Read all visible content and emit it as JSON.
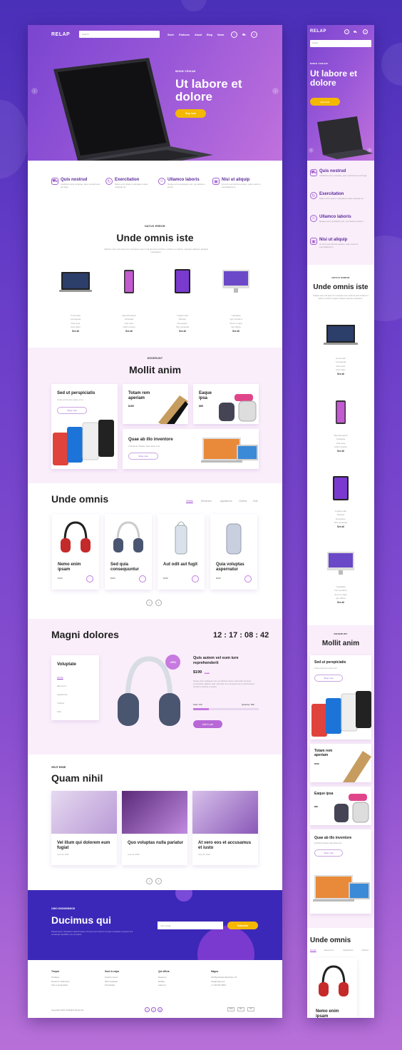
{
  "brand": "RELAP",
  "search_placeholder": "Search",
  "nav": [
    "Store",
    "Features",
    "About",
    "Blog",
    "News"
  ],
  "hero": {
    "kicker": "MINIM VENIAM",
    "title": "Ut labore et dolore",
    "button": "Buy now"
  },
  "features": [
    {
      "icon": "truck-icon",
      "title": "Quis nostrud",
      "text": "Incididunt quis voluptas, quis nostrud sed est fugit."
    },
    {
      "icon": "refresh-icon",
      "title": "Exercitation",
      "text": "Natus error ipsam voluptatem quia voluptas sit."
    },
    {
      "icon": "support-icon",
      "title": "Ullamco laboris",
      "text": "Neque porro quisquam est, qui dolorem ipsum."
    },
    {
      "icon": "box-icon",
      "title": "Nisi ut aliquip",
      "text": "Ut enim ad minima veniam, quis nostrum exercitationem."
    }
  ],
  "catalog": {
    "kicker": "NATUS ERROR",
    "title": "Unde omnis iste",
    "text": "Adipisci velit, sed quia non numquam eius modi tempora incidunt ut labore et dolore magnam aliquam quaerat voluptatem.",
    "products": [
      {
        "specs": [
          "Commodo",
          "Consequat",
          "Duis aute",
          "Irure dolor"
        ],
        "all": "See all"
      },
      {
        "specs": [
          "Reprehenderit",
          "Voluptate",
          "Velit esse",
          "Cillum dolore"
        ],
        "all": "See all"
      },
      {
        "specs": [
          "Fugiat nulla",
          "Pariatur",
          "Excepteur",
          "Sint occaecat"
        ],
        "all": "See all"
      },
      {
        "specs": [
          "Cupidatat",
          "Non proident",
          "Sunt in culpa",
          "Qui officia"
        ],
        "all": "See all"
      }
    ]
  },
  "promo": {
    "kicker": "DESERUNT",
    "title": "Mollit anim",
    "c1": {
      "title": "Sed ut perspiciatis",
      "text": "Unde omnis iste natus error",
      "btn": "Shop now"
    },
    "c2": {
      "title": "Totam rem aperiam",
      "price": "$199"
    },
    "c3": {
      "title": "Eaque ipsa",
      "price": "$89"
    },
    "c4": {
      "title": "Quae ab illo inventore",
      "text": "Architecto beatae vitae dicta sunt",
      "btn": "Shop now"
    }
  },
  "shop": {
    "title": "Unde omnis",
    "tabs": [
      "Omnis",
      "Electronic",
      "Appliances",
      "Clothes",
      "Kids"
    ],
    "items": [
      {
        "name": "Nemo enim ipsam",
        "price": "$180"
      },
      {
        "name": "Sed quia consequuntur",
        "price": "$180"
      },
      {
        "name": "Aut odit aut fugit",
        "price": "$180"
      },
      {
        "name": "Quia voluptas aspernatur",
        "price": "$180"
      }
    ]
  },
  "deal": {
    "title": "Magni dolores",
    "timer": "12 : 17 : 08 : 42",
    "menu_title": "Voluptate",
    "menu": [
      "Omnis",
      "Electronic",
      "Appliances",
      "Clothes",
      "Kids"
    ],
    "badge": "-15%",
    "name": "Quis autem vel eum iure reprehenderit",
    "price": "$199",
    "old": "$235",
    "text": "Neque porro quisquam est, qui dolorem ipsum quia dolor sit amet, consectetur, adipisci velit, sed quia non numquam eius modi tempora incidunt ut labore et dolore.",
    "sold": "Sold: 120",
    "qty": "Quantity: 500",
    "progress": 0.24,
    "btn": "Add to cart"
  },
  "blog": {
    "kicker": "VELIT ESSE",
    "title": "Quam nihil",
    "posts": [
      {
        "title": "Vel illum qui dolorem eum fugiat",
        "date": "June 01, 2019"
      },
      {
        "title": "Quo voluptas nulla pariatur",
        "date": "June 01, 2019"
      },
      {
        "title": "At vero eos et accusamus et iusto",
        "date": "June 01, 2019"
      }
    ]
  },
  "news": {
    "kicker": "ODIO DIGNISSIMOS",
    "title": "Ducimus qui",
    "text": "Praesentium voluptatum deleniti atque corrupti quos dolores et quas molestias excepturi sint occaecati cupiditate non provident.",
    "placeholder": "Your email",
    "btn": "Subscribe"
  },
  "footer": {
    "cols": [
      {
        "title": "Tempor",
        "items": [
          "Similique",
          "Deserunt mollit anim",
          "Sed ut perspiciatis"
        ]
      },
      {
        "title": "Sunt in culpa",
        "items": [
          "Nostrum exerc",
          "Nihil molestiae",
          "Perspiciatis"
        ]
      },
      {
        "title": "Qui officia",
        "items": [
          "Deserunt",
          "Mollitia",
          "Laborum"
        ]
      },
      {
        "title": "Magna",
        "items": [
          "220 Bgmbsdieu Buschas, NJ",
          "info@relap.com",
          "+1 234 567 8910"
        ]
      }
    ],
    "copy": "Copyright 2019. All Rights Reserved.",
    "pay": [
      "VISA",
      "MC",
      "PP"
    ]
  },
  "colors": {
    "purple": "#8a4fd0",
    "yellow": "#f5b800",
    "navy": "#3b28b8",
    "pink": "#faeefb"
  }
}
